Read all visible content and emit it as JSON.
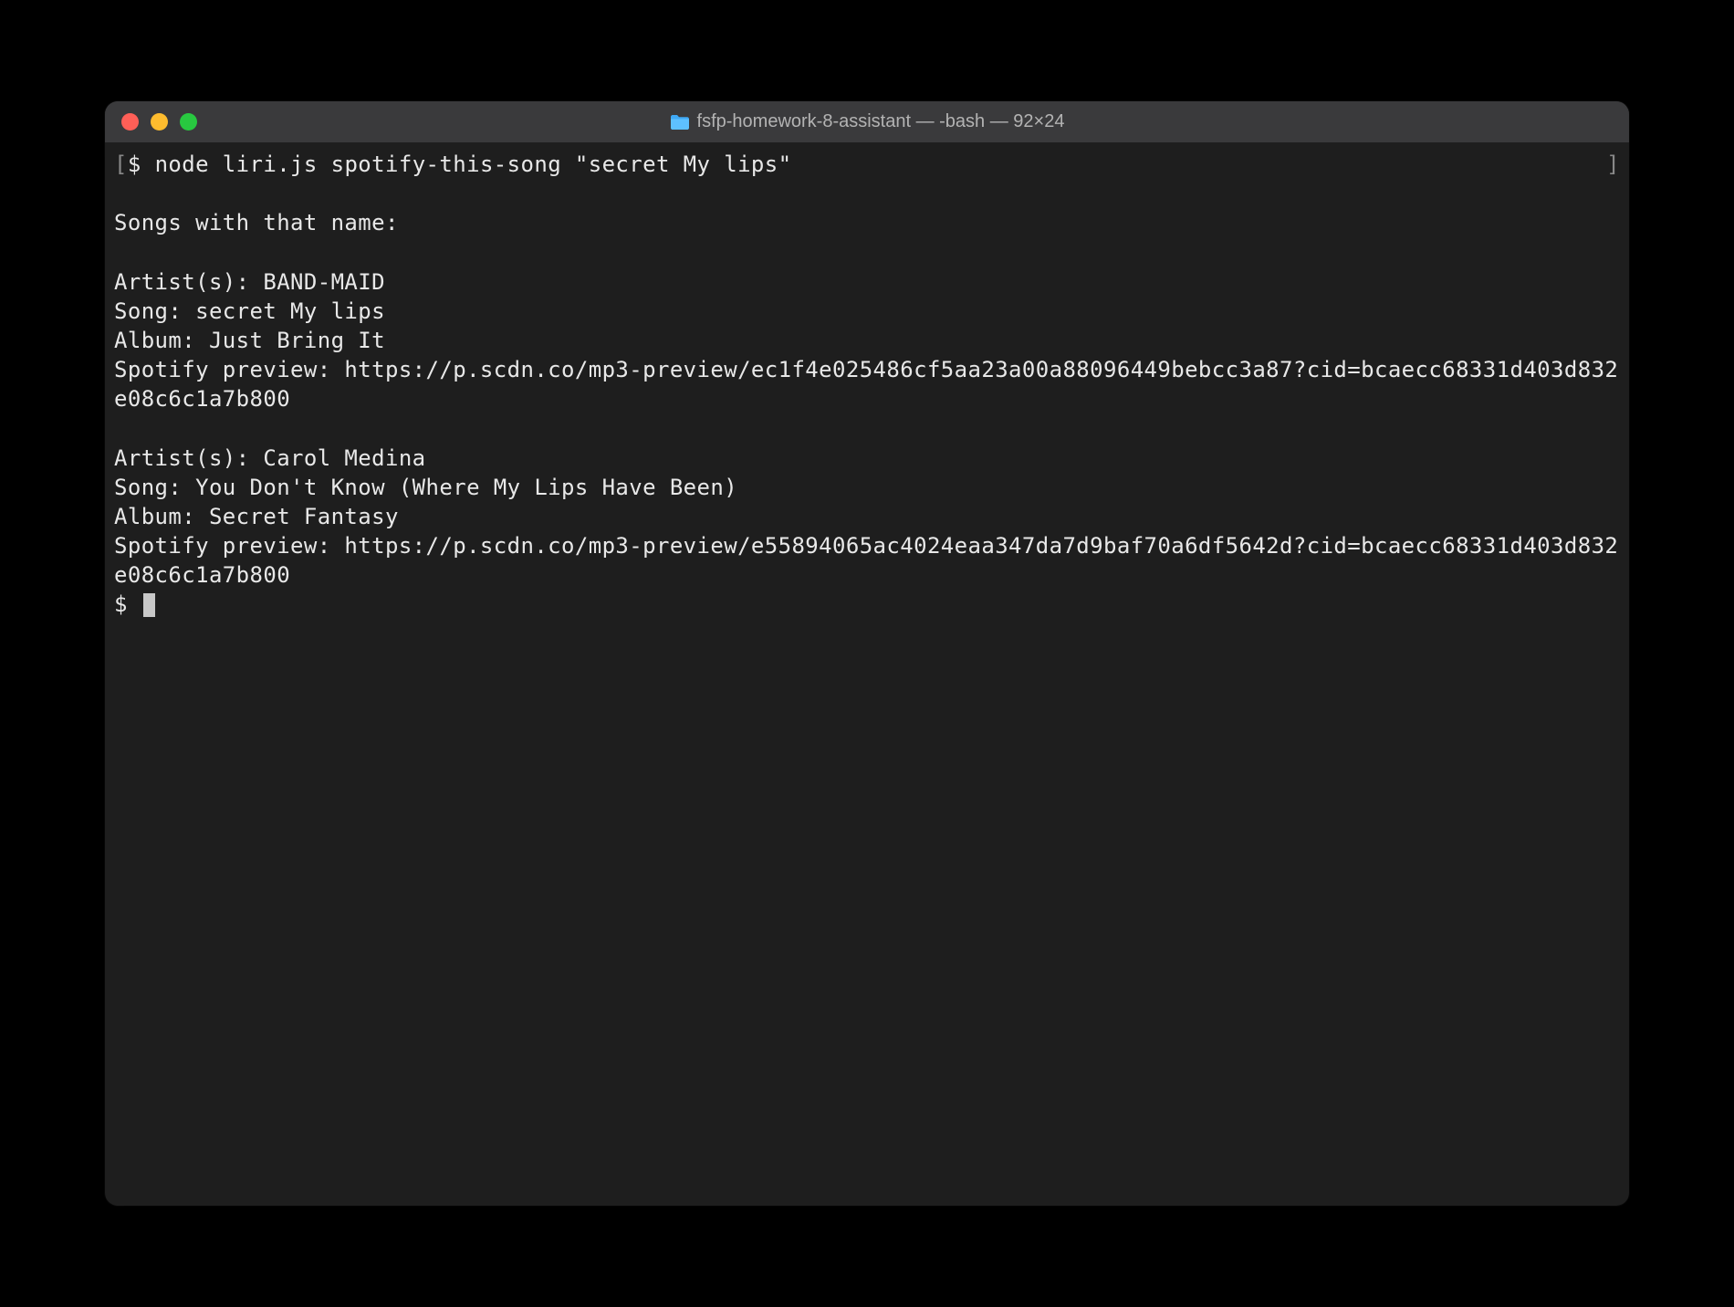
{
  "titlebar": {
    "title": "fsfp-homework-8-assistant — -bash — 92×24"
  },
  "terminal": {
    "line1_bracket": "[",
    "line1_prompt": "$ ",
    "line1_cmd": "node liri.js spotify-this-song \"secret My lips\"",
    "line1_end": "]",
    "blank": "",
    "heading": "Songs with that name:",
    "r1_artist": "Artist(s): BAND-MAID",
    "r1_song": "Song: secret My lips",
    "r1_album": "Album: Just Bring It",
    "r1_preview": "Spotify preview: https://p.scdn.co/mp3-preview/ec1f4e025486cf5aa23a00a88096449bebcc3a87?cid=bcaecc68331d403d832e08c6c1a7b800",
    "r2_artist": "Artist(s): Carol Medina",
    "r2_song": "Song: You Don't Know (Where My Lips Have Been)",
    "r2_album": "Album: Secret Fantasy",
    "r2_preview": "Spotify preview: https://p.scdn.co/mp3-preview/e55894065ac4024eaa347da7d9baf70a6df5642d?cid=bcaecc68331d403d832e08c6c1a7b800",
    "prompt2": "$ "
  }
}
